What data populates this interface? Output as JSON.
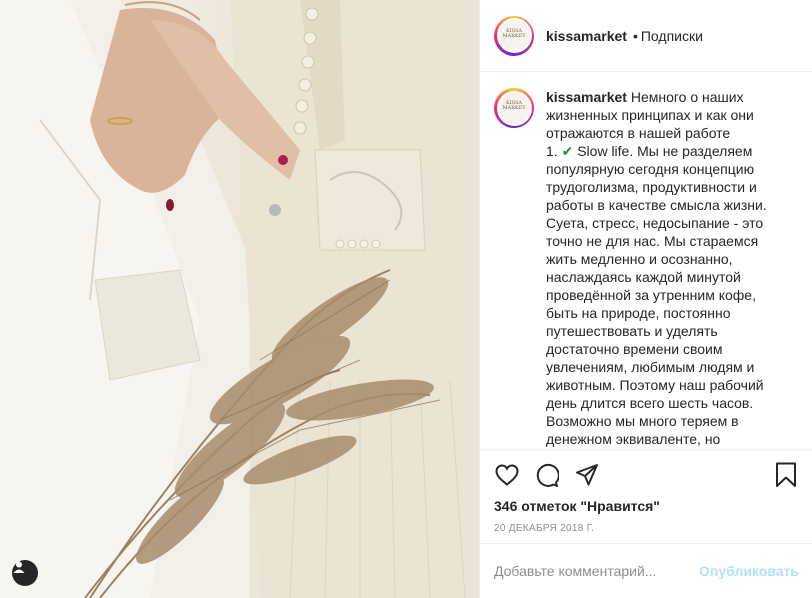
{
  "post": {
    "username": "kissamarket",
    "dot": "•",
    "follow_label": "Подписки",
    "avatar_logo_text": "KISSA MARKET",
    "caption_username": "kissamarket",
    "caption_line1": "Немного о наших жизненных принципах и как они отражаются в нашей работе",
    "caption_item_num": "1.",
    "caption_check": "✔",
    "caption_body": "Slow life. Мы не разделяем популярную сегодня концепцию трудоголизма, продуктивности и работы в качестве смысла жизни. Суета, стресс, недосыпание - это точно не для нас. Мы стараемся жить медленно и осознанно, наслаждаясь каждой минутой проведённой за утренним кофе, быть на природе, постоянно путешествовать и уделять достаточно времени своим увлечениям, любимым людям и животным. Поэтому наш рабочий день длится всего шесть часов. Возможно мы много теряем в денежном эквиваленте, но",
    "likes": "346 отметок \"Нравится\"",
    "date": "20 декабря 2018 г."
  },
  "comment": {
    "placeholder": "Добавьте комментарий...",
    "publish_label": "Опубликовать"
  },
  "icons": {
    "like": "heart-icon",
    "comment": "comment-icon",
    "share": "share-icon",
    "save": "bookmark-icon",
    "user": "user-icon"
  },
  "colors": {
    "text": "#262626",
    "muted": "#8e8e8e",
    "publish_disabled": "#b2dffc",
    "check": "#2e8b2e"
  }
}
